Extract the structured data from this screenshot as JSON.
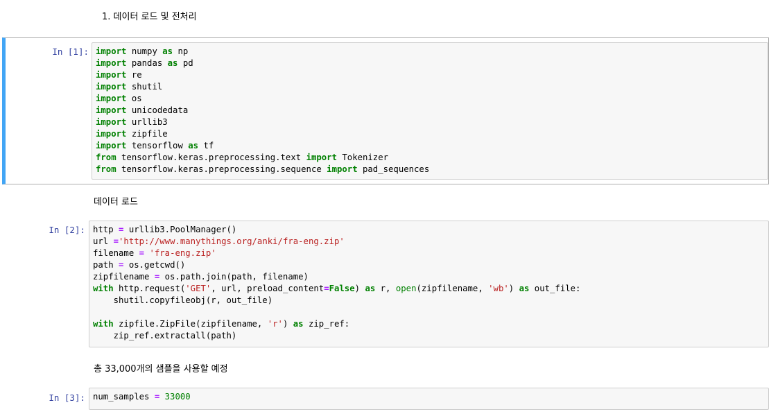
{
  "markdown": {
    "heading": "1. 데이터 로드 및 전처리",
    "data_load": "데이터 로드",
    "samples_note": "총 33,000개의 샘플을 사용할 예정"
  },
  "cells": [
    {
      "prompt": "In [1]:",
      "lines": [
        [
          {
            "t": "import",
            "c": "kw"
          },
          {
            "t": " numpy ",
            "c": ""
          },
          {
            "t": "as",
            "c": "kw"
          },
          {
            "t": " np",
            "c": ""
          }
        ],
        [
          {
            "t": "import",
            "c": "kw"
          },
          {
            "t": " pandas ",
            "c": ""
          },
          {
            "t": "as",
            "c": "kw"
          },
          {
            "t": " pd",
            "c": ""
          }
        ],
        [
          {
            "t": "import",
            "c": "kw"
          },
          {
            "t": " re",
            "c": ""
          }
        ],
        [
          {
            "t": "import",
            "c": "kw"
          },
          {
            "t": " shutil",
            "c": ""
          }
        ],
        [
          {
            "t": "import",
            "c": "kw"
          },
          {
            "t": " os",
            "c": ""
          }
        ],
        [
          {
            "t": "import",
            "c": "kw"
          },
          {
            "t": " unicodedata",
            "c": ""
          }
        ],
        [
          {
            "t": "import",
            "c": "kw"
          },
          {
            "t": " urllib3",
            "c": ""
          }
        ],
        [
          {
            "t": "import",
            "c": "kw"
          },
          {
            "t": " zipfile",
            "c": ""
          }
        ],
        [
          {
            "t": "import",
            "c": "kw"
          },
          {
            "t": " tensorflow ",
            "c": ""
          },
          {
            "t": "as",
            "c": "kw"
          },
          {
            "t": " tf",
            "c": ""
          }
        ],
        [
          {
            "t": "from",
            "c": "kw"
          },
          {
            "t": " tensorflow.keras.preprocessing.text ",
            "c": ""
          },
          {
            "t": "import",
            "c": "kw"
          },
          {
            "t": " Tokenizer",
            "c": ""
          }
        ],
        [
          {
            "t": "from",
            "c": "kw"
          },
          {
            "t": " tensorflow.keras.preprocessing.sequence ",
            "c": ""
          },
          {
            "t": "import",
            "c": "kw"
          },
          {
            "t": " pad_sequences",
            "c": ""
          }
        ]
      ]
    },
    {
      "prompt": "In [2]:",
      "lines": [
        [
          {
            "t": "http ",
            "c": ""
          },
          {
            "t": "=",
            "c": "op"
          },
          {
            "t": " urllib3.PoolManager()",
            "c": ""
          }
        ],
        [
          {
            "t": "url ",
            "c": ""
          },
          {
            "t": "=",
            "c": "op"
          },
          {
            "t": "'http://www.manythings.org/anki/fra-eng.zip'",
            "c": "str"
          }
        ],
        [
          {
            "t": "filename ",
            "c": ""
          },
          {
            "t": "=",
            "c": "op"
          },
          {
            "t": " ",
            "c": ""
          },
          {
            "t": "'fra-eng.zip'",
            "c": "str"
          }
        ],
        [
          {
            "t": "path ",
            "c": ""
          },
          {
            "t": "=",
            "c": "op"
          },
          {
            "t": " os.getcwd()",
            "c": ""
          }
        ],
        [
          {
            "t": "zipfilename ",
            "c": ""
          },
          {
            "t": "=",
            "c": "op"
          },
          {
            "t": " os.path.join(path, filename)",
            "c": ""
          }
        ],
        [
          {
            "t": "with",
            "c": "kw"
          },
          {
            "t": " http.request(",
            "c": ""
          },
          {
            "t": "'GET'",
            "c": "str"
          },
          {
            "t": ", url, preload_content",
            "c": ""
          },
          {
            "t": "=",
            "c": "op"
          },
          {
            "t": "False",
            "c": "kw"
          },
          {
            "t": ") ",
            "c": ""
          },
          {
            "t": "as",
            "c": "kw"
          },
          {
            "t": " r, ",
            "c": ""
          },
          {
            "t": "open",
            "c": "num"
          },
          {
            "t": "(zipfilename, ",
            "c": ""
          },
          {
            "t": "'wb'",
            "c": "str"
          },
          {
            "t": ") ",
            "c": ""
          },
          {
            "t": "as",
            "c": "kw"
          },
          {
            "t": " out_file:",
            "c": ""
          }
        ],
        [
          {
            "t": "    shutil.copyfileobj(r, out_file)",
            "c": ""
          }
        ],
        [],
        [
          {
            "t": "with",
            "c": "kw"
          },
          {
            "t": " zipfile.ZipFile(zipfilename, ",
            "c": ""
          },
          {
            "t": "'r'",
            "c": "str"
          },
          {
            "t": ") ",
            "c": ""
          },
          {
            "t": "as",
            "c": "kw"
          },
          {
            "t": " zip_ref:",
            "c": ""
          }
        ],
        [
          {
            "t": "    zip_ref.extractall(path)",
            "c": ""
          }
        ]
      ]
    },
    {
      "prompt": "In [3]:",
      "lines": [
        [
          {
            "t": "num_samples ",
            "c": ""
          },
          {
            "t": "=",
            "c": "op"
          },
          {
            "t": " ",
            "c": ""
          },
          {
            "t": "33000",
            "c": "num"
          }
        ]
      ]
    }
  ]
}
